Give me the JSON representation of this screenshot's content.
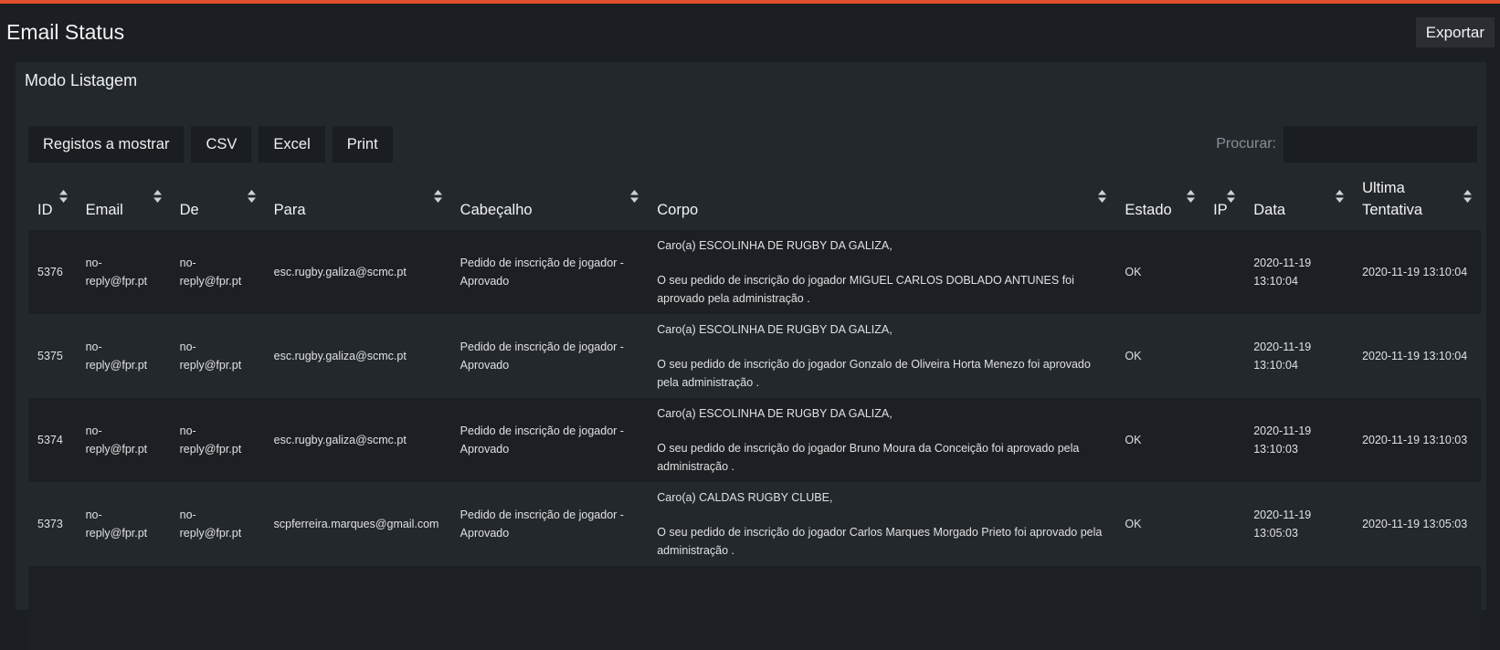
{
  "header": {
    "title": "Email Status",
    "export_label": "Exportar"
  },
  "panel": {
    "title": "Modo Listagem"
  },
  "toolbar": {
    "show_label": "Registos a mostrar",
    "csv_label": "CSV",
    "excel_label": "Excel",
    "print_label": "Print"
  },
  "search": {
    "label": "Procurar:",
    "value": ""
  },
  "columns": [
    "ID",
    "Email",
    "De",
    "Para",
    "Cabeçalho",
    "Corpo",
    "Estado",
    "IP",
    "Data",
    "Ultima Tentativa"
  ],
  "rows": [
    {
      "id": "5376",
      "email": "no-reply@fpr.pt",
      "de": "no-reply@fpr.pt",
      "para": "esc.rugby.galiza@scmc.pt",
      "cabecalho": "Pedido de inscrição de jogador - Aprovado",
      "corpo_greeting": "Caro(a) ESCOLINHA DE RUGBY DA GALIZA,",
      "corpo_body": "O seu pedido de inscrição do jogador MIGUEL CARLOS DOBLADO ANTUNES foi aprovado pela administração .",
      "estado": "OK",
      "ip": "",
      "data": "2020-11-19 13:10:04",
      "ultima": "2020-11-19 13:10:04"
    },
    {
      "id": "5375",
      "email": "no-reply@fpr.pt",
      "de": "no-reply@fpr.pt",
      "para": "esc.rugby.galiza@scmc.pt",
      "cabecalho": "Pedido de inscrição de jogador - Aprovado",
      "corpo_greeting": "Caro(a) ESCOLINHA DE RUGBY DA GALIZA,",
      "corpo_body": "O seu pedido de inscrição do jogador Gonzalo de Oliveira Horta Menezo foi aprovado pela administração .",
      "estado": "OK",
      "ip": "",
      "data": "2020-11-19 13:10:04",
      "ultima": "2020-11-19 13:10:04"
    },
    {
      "id": "5374",
      "email": "no-reply@fpr.pt",
      "de": "no-reply@fpr.pt",
      "para": "esc.rugby.galiza@scmc.pt",
      "cabecalho": "Pedido de inscrição de jogador - Aprovado",
      "corpo_greeting": "Caro(a) ESCOLINHA DE RUGBY DA GALIZA,",
      "corpo_body": "O seu pedido de inscrição do jogador Bruno Moura da Conceição foi aprovado pela administração .",
      "estado": "OK",
      "ip": "",
      "data": "2020-11-19 13:10:03",
      "ultima": "2020-11-19 13:10:03"
    },
    {
      "id": "5373",
      "email": "no-reply@fpr.pt",
      "de": "no-reply@fpr.pt",
      "para": "scpferreira.marques@gmail.com",
      "cabecalho": "Pedido de inscrição de jogador - Aprovado",
      "corpo_greeting": "Caro(a) CALDAS RUGBY CLUBE,",
      "corpo_body": "O seu pedido de inscrição do jogador Carlos Marques Morgado Prieto foi aprovado pela administração .",
      "estado": "OK",
      "ip": "",
      "data": "2020-11-19 13:05:03",
      "ultima": "2020-11-19 13:05:03"
    }
  ],
  "colors": {
    "accent": "#e0502c",
    "background": "#1b1e22",
    "panel": "#23282d",
    "row_dark": "#1c2024"
  },
  "icons": {
    "sort": "sort-icon"
  }
}
